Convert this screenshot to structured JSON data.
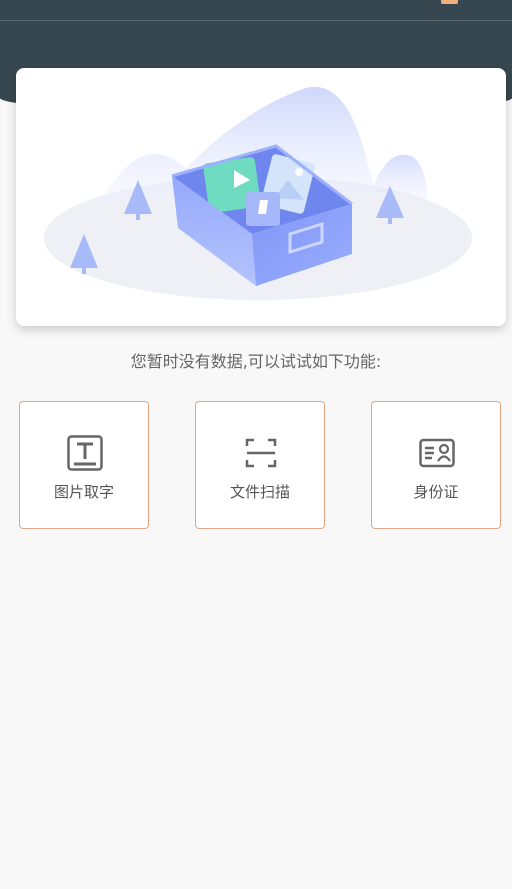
{
  "empty_state": {
    "message": "您暂时没有数据,可以试试如下功能:"
  },
  "features": [
    {
      "label": "图片取字",
      "icon": "text-recognition-icon"
    },
    {
      "label": "文件扫描",
      "icon": "scan-frame-icon"
    },
    {
      "label": "身份证",
      "icon": "id-card-icon"
    }
  ],
  "colors": {
    "header_bg": "#37474f",
    "accent": "#f0b07a",
    "card_border": "#e8a689",
    "page_bg": "#f8f8f8"
  }
}
